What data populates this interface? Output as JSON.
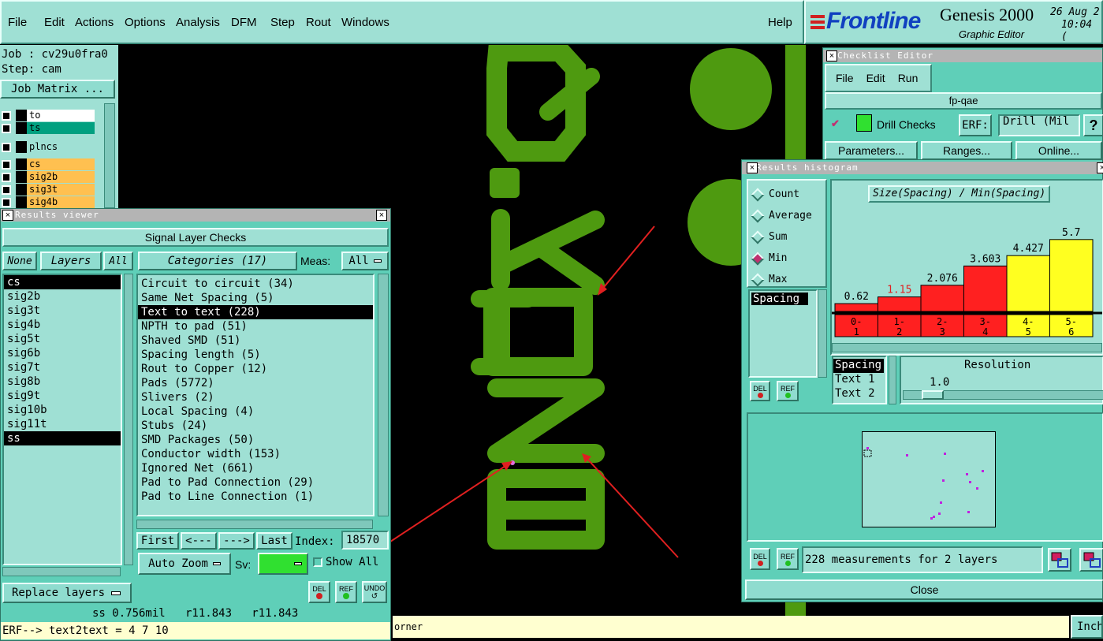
{
  "menubar": {
    "items": [
      "File",
      "Edit",
      "Actions",
      "Options",
      "Analysis",
      "DFM",
      "Step",
      "Rout",
      "Windows"
    ],
    "help": "Help"
  },
  "brand": {
    "logo": "Frontline",
    "product": "Genesis 2000",
    "subtitle": "Graphic Editor",
    "date": "26 Aug 2",
    "time": "10:04 ("
  },
  "job": {
    "job_label": "Job : cv29u0fra0",
    "step_label": "Step: cam",
    "matrix_button": "Job Matrix ..."
  },
  "layer_panel": {
    "layers": [
      {
        "name": "to",
        "color": "#ffffff"
      },
      {
        "name": "ts",
        "color": "#00a080"
      },
      {
        "name": "plncs",
        "color": "#9fe0d4"
      },
      {
        "name": "cs",
        "color": "#ffc050"
      },
      {
        "name": "sig2b",
        "color": "#ffc050"
      },
      {
        "name": "sig3t",
        "color": "#ffc050"
      },
      {
        "name": "sig4b",
        "color": "#ffc050"
      }
    ]
  },
  "results_viewer": {
    "title": "Results viewer",
    "header": "Signal Layer Checks",
    "none_btn": "None",
    "layers_btn": "Layers",
    "all_btn": "All",
    "layers": [
      "cs",
      "sig2b",
      "sig3t",
      "sig4b",
      "sig5t",
      "sig6b",
      "sig7t",
      "sig8b",
      "sig9t",
      "sig10b",
      "sig11t",
      "ss"
    ],
    "categories_label": "Categories (17)",
    "meas_label": "Meas:",
    "meas_value": "All",
    "categories": [
      "Circuit to circuit (34)",
      "Same Net Spacing (5)",
      "Text to text (228)",
      "NPTH to pad (51)",
      "Shaved SMD (51)",
      "Spacing length (5)",
      "Rout to Copper (12)",
      "Pads (5772)",
      "Slivers (2)",
      "Local Spacing (4)",
      "Stubs (24)",
      "SMD Packages (50)",
      "Conductor width (153)",
      "Ignored Net (661)",
      "Pad to Pad Connection (29)",
      "Pad to Line Connection (1)"
    ],
    "first_btn": "First",
    "prev_btn": "<---",
    "next_btn": "--->",
    "last_btn": "Last",
    "index_label": "Index:",
    "index_value": "18570",
    "auto_zoom": "Auto Zoom",
    "sv_label": "Sv:",
    "show_all": "Show All",
    "replace_layers": "Replace layers",
    "del": "DEL",
    "ref": "REF",
    "undo": "UNDO",
    "status": "ss 0.756mil   r11.843   r11.843",
    "erf_line": "ERF--> text2text = 4 7 10"
  },
  "bottom_status": {
    "message": "orner",
    "units": "Inch"
  },
  "checklist": {
    "title": "Checklist Editor",
    "menu": [
      "File",
      "Edit",
      "Run"
    ],
    "name": "fp-qae",
    "check_name": "Drill Checks",
    "erf_label": "ERF:",
    "erf_value": "Drill (Mil",
    "help": "?",
    "parameters": "Parameters...",
    "ranges": "Ranges...",
    "online": "Online..."
  },
  "histogram": {
    "title": "Results histogram",
    "modes": [
      "Count",
      "Average",
      "Sum",
      "Min",
      "Max"
    ],
    "selected_mode": "Min",
    "chart_title": "Size(Spacing) / Min(Spacing)",
    "list_item": "Spacing",
    "spacing_label": "Spacing",
    "text1": "Text 1",
    "text2": "Text 2",
    "resolution_label": "Resolution",
    "resolution_value": "1.0",
    "del": "DEL",
    "ref": "REF",
    "summary": "228 measurements for 2 layers",
    "close": "Close"
  },
  "chart_data": {
    "type": "bar",
    "title": "Size(Spacing) / Min(Spacing)",
    "categories": [
      "0-1",
      "1-2",
      "2-3",
      "3-4",
      "4-5",
      "5-6"
    ],
    "values": [
      0.62,
      1.15,
      2.076,
      3.603,
      4.427,
      5.7
    ],
    "value_labels": [
      "0.62",
      "1.15",
      "2.076",
      "3.603",
      "4.427",
      "5.7"
    ],
    "bar_colors": [
      "#ff2020",
      "#ff2020",
      "#ff2020",
      "#ff2020",
      "#ffff20",
      "#ffff20"
    ],
    "ylim": [
      0,
      6
    ]
  },
  "colors": {
    "panel": "#9fe0d4",
    "copper": "#4e9a10",
    "arrow": "#e02020"
  }
}
